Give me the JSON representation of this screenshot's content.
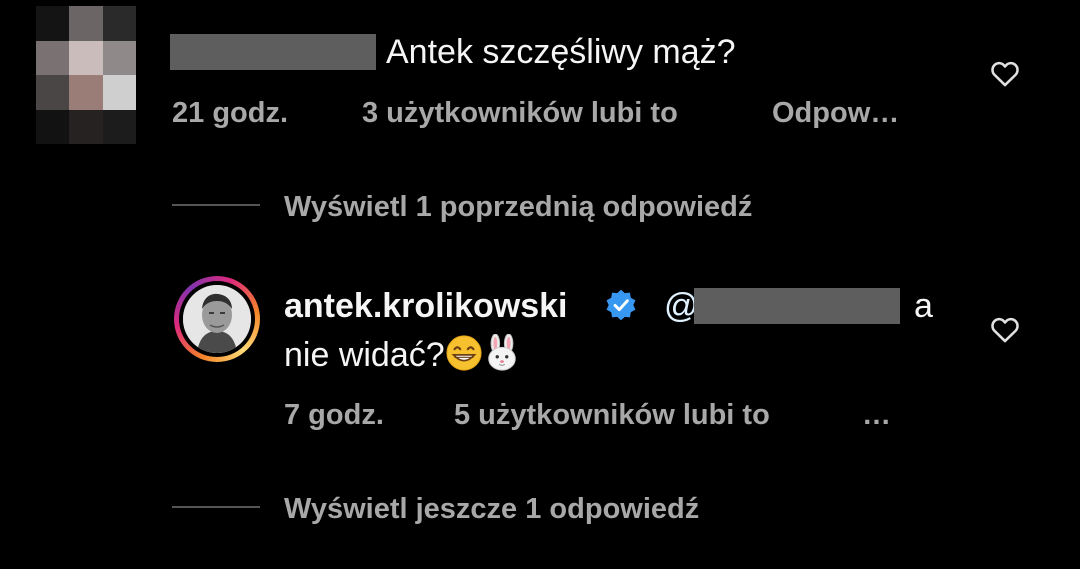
{
  "thread": {
    "parent_comment": {
      "text": "Antek szczęśliwy mąż?",
      "time": "21 godz.",
      "likes": "3 użytkowników lubi to",
      "reply": "Odpow…"
    },
    "view_previous": "Wyświetl 1 poprzednią odpowiedź",
    "reply_comment": {
      "username": "antek.krolikowski",
      "mention_prefix": "@",
      "text_after_mention": "a",
      "text_line2": "nie widać?",
      "time": "7 godz.",
      "likes": "5 użytkowników lubi to",
      "more": "…",
      "verified_color": "#3897f0"
    },
    "view_more": "Wyświetl jeszcze 1 odpowiedź"
  }
}
